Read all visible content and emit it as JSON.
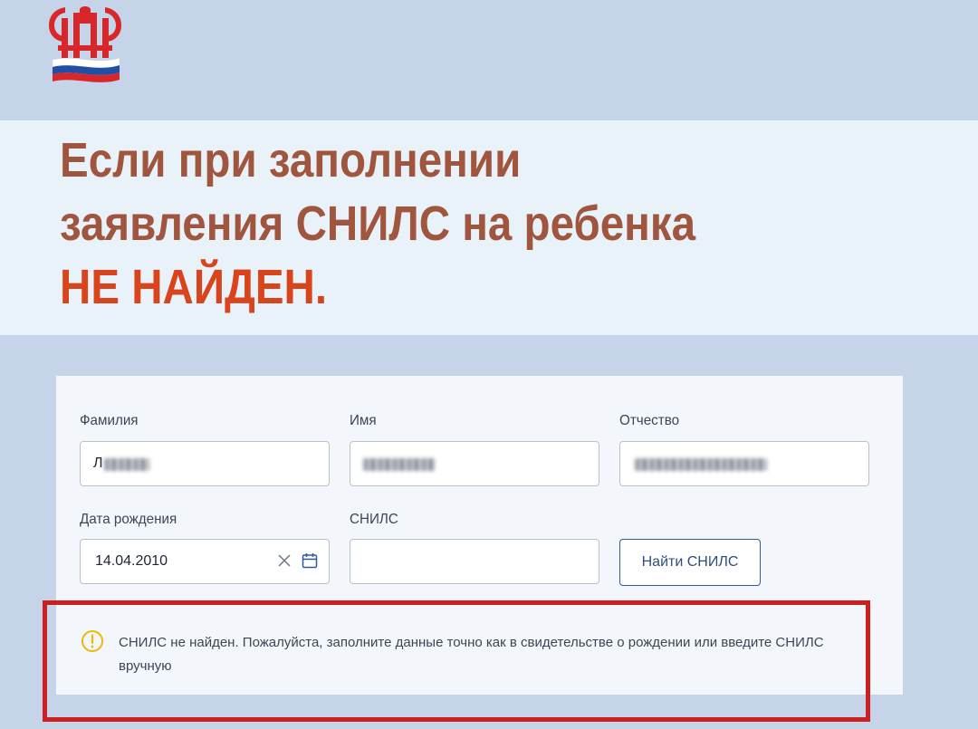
{
  "logo": {
    "icon": "pfr-logo-icon"
  },
  "headline": {
    "line1": "Если при заполнении",
    "line2": "заявления СНИЛС на ребенка",
    "line3": "НЕ НАЙДЕН."
  },
  "form": {
    "surname": {
      "label": "Фамилия",
      "value_prefix": "Л"
    },
    "name": {
      "label": "Имя"
    },
    "patronymic": {
      "label": "Отчество"
    },
    "birth_date": {
      "label": "Дата рождения",
      "value": "14.04.2010"
    },
    "snils": {
      "label": "СНИЛС",
      "value": ""
    },
    "find_button_label": "Найти СНИЛС"
  },
  "alert": {
    "icon": "warning-icon",
    "message": "СНИЛС не найден. Пожалуйста, заполните данные точно как в свидетельстве о рождении или введите СНИЛС вручную"
  },
  "colors": {
    "headline": "#a0553e",
    "headline_accent": "#d9441c",
    "highlight_frame": "#cc1f1f",
    "button_text": "#2d4f80",
    "warning": "#f2b705"
  }
}
